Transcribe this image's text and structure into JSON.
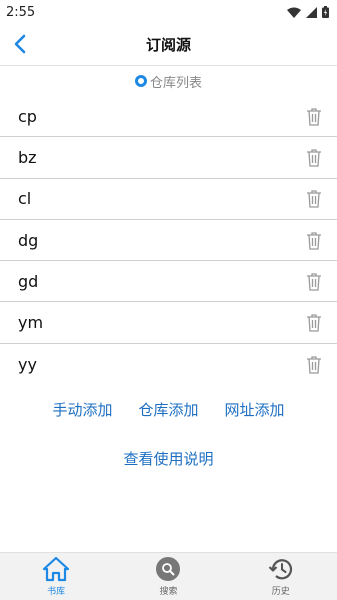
{
  "status_bar": {
    "time": "2:55"
  },
  "app_bar": {
    "title": "订阅源"
  },
  "repo_toggle": {
    "label": "仓库列表"
  },
  "sources": [
    {
      "name": "cp"
    },
    {
      "name": "bz"
    },
    {
      "name": "cl"
    },
    {
      "name": "dg"
    },
    {
      "name": "gd"
    },
    {
      "name": "ym"
    },
    {
      "name": "yy"
    }
  ],
  "actions": {
    "manual_add": "手动添加",
    "repo_add": "仓库添加",
    "url_add": "网址添加",
    "help": "查看使用说明"
  },
  "bottom_nav": {
    "library": "书库",
    "search": "搜索",
    "history": "历史"
  },
  "colors": {
    "accent": "#1e88e5",
    "link": "#1e6fc2"
  }
}
